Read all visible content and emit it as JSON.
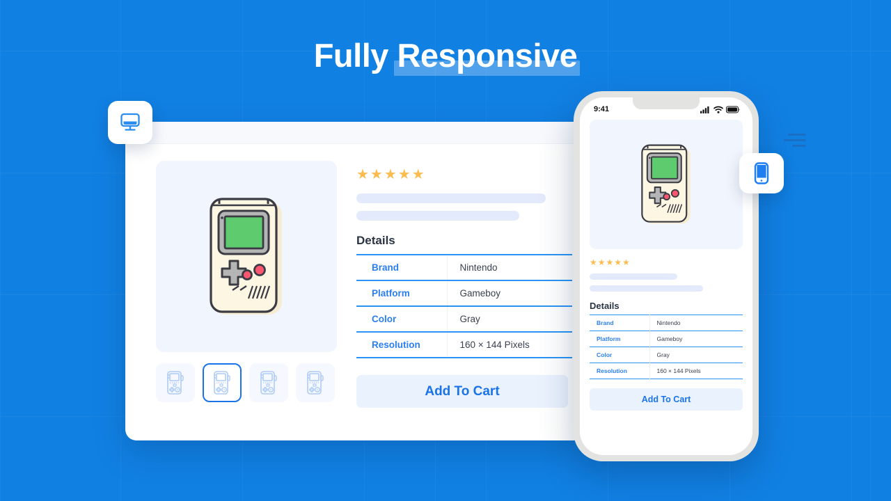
{
  "hero": {
    "title_lead": "Fully ",
    "title_highlight": "Responsive"
  },
  "badges": {
    "desktop_icon": "desktop-monitor-icon",
    "mobile_icon": "mobile-phone-icon"
  },
  "decoration": {
    "menu_lines_icon": "menu-lines-icon"
  },
  "desktop": {
    "product_image_alt": "gameboy-illustration",
    "thumbnails": [
      {
        "label": "thumbnail-1",
        "selected": false
      },
      {
        "label": "thumbnail-2",
        "selected": true
      },
      {
        "label": "thumbnail-3",
        "selected": false
      },
      {
        "label": "thumbnail-4",
        "selected": false
      }
    ],
    "rating_stars": "★★★★★",
    "rating_value": 5,
    "details_heading": "Details",
    "details_rows": [
      {
        "key": "Brand",
        "value": "Nintendo"
      },
      {
        "key": "Platform",
        "value": "Gameboy"
      },
      {
        "key": "Color",
        "value": "Gray"
      },
      {
        "key": "Resolution",
        "value": "160 × 144 Pixels"
      }
    ],
    "cart_button": "Add To Cart"
  },
  "mobile": {
    "status_time": "9:41",
    "status_icons": [
      "cellular-signal-icon",
      "wifi-icon",
      "battery-icon"
    ],
    "product_image_alt": "gameboy-illustration",
    "rating_stars": "★★★★★",
    "rating_value": 5,
    "details_heading": "Details",
    "details_rows": [
      {
        "key": "Brand",
        "value": "Nintendo"
      },
      {
        "key": "Platform",
        "value": "Gameboy"
      },
      {
        "key": "Color",
        "value": "Gray"
      },
      {
        "key": "Resolution",
        "value": "160 × 144 Pixels"
      }
    ],
    "cart_button": "Add To Cart"
  },
  "colors": {
    "background_blue": "#1180e3",
    "accent_blue": "#1a73e8",
    "link_blue": "#2a7ff0",
    "star_orange": "#fbbc50",
    "placeholder_blue": "#e2eafb",
    "image_bg": "#f1f5fd",
    "gameboy_body": "#faf0dc",
    "gameboy_screen": "#5ecb6e",
    "gameboy_bezel": "#a9a9a9",
    "gameboy_button_pink": "#f9566f",
    "phone_frame": "#e3e4e2"
  }
}
